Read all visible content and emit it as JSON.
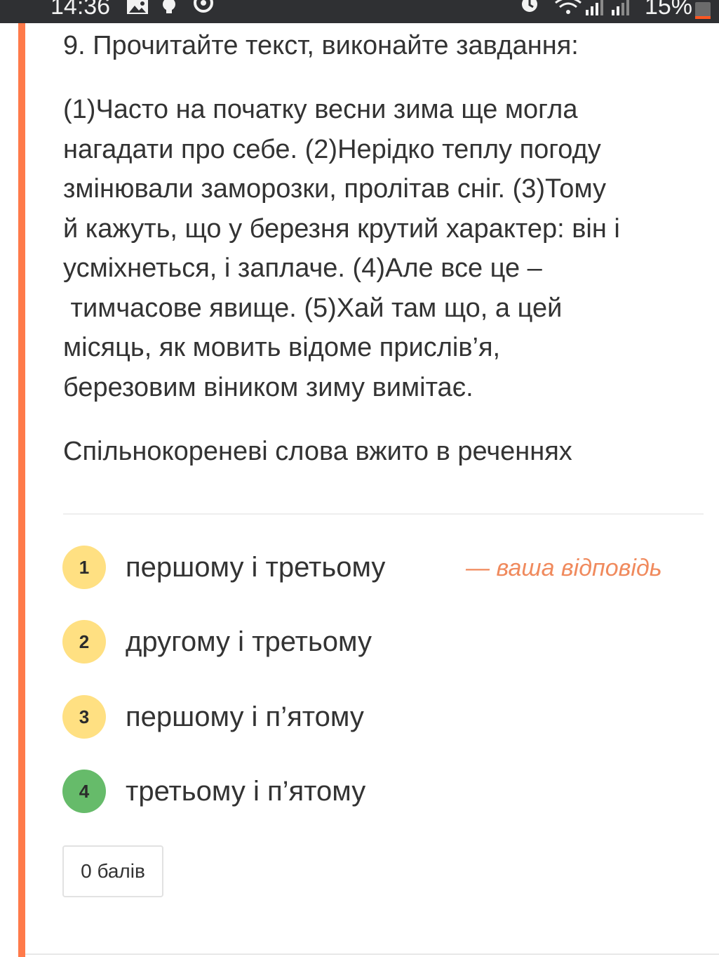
{
  "status_bar": {
    "time": "14:36",
    "battery": "15%",
    "battery_level": 0.15,
    "icons": [
      "image-icon",
      "bulb-icon",
      "sync-icon",
      "alarm-icon",
      "wifi-icon",
      "signal-icon",
      "signal-icon-2"
    ]
  },
  "question": {
    "title": "9. Прочитайте текст, виконайте завдання:",
    "passage_lines": [
      "(1)Часто на початку весни зима ще могла",
      "нагадати про себе. (2)Нерідко теплу погоду",
      "змінювали заморозки, пролітав сніг. (3)Тому",
      "й кажуть, що у березня крутий характер: він і",
      "усміхнеться, і заплаче. (4)Але все це –",
      " тимчасове явище. (5)Хай там що, а цей",
      "місяць, як мовить відоме прислів’я,",
      "березовим віником зиму вимітає."
    ],
    "prompt": "Спільнокореневі слова вжито в реченнях"
  },
  "options": [
    {
      "number": "1",
      "label": "першому і третьому",
      "state": "selected"
    },
    {
      "number": "2",
      "label": "другому і третьому",
      "state": "normal"
    },
    {
      "number": "3",
      "label": "першому і п’ятому",
      "state": "normal"
    },
    {
      "number": "4",
      "label": "третьому і п’ятому",
      "state": "correct"
    }
  ],
  "your_answer_label": "— ваша відповідь",
  "score": "0 балів",
  "colors": {
    "accent": "#ff7a4a",
    "badge_default": "#ffe082",
    "badge_correct": "#66bb6a",
    "your_answer": "#f08a5d"
  }
}
